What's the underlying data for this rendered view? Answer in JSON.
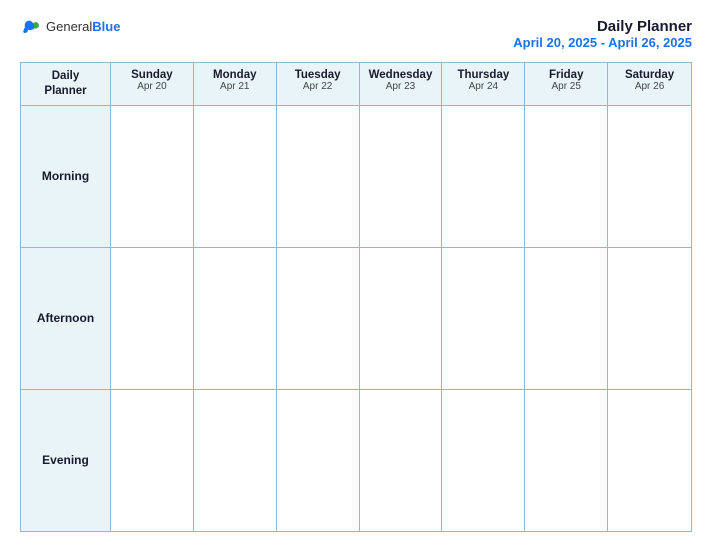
{
  "logo": {
    "general": "General",
    "blue": "Blue"
  },
  "title": {
    "main": "Daily Planner",
    "dates": "April 20, 2025 - April 26, 2025"
  },
  "header": {
    "label_line1": "Daily",
    "label_line2": "Planner",
    "columns": [
      {
        "day": "Sunday",
        "date": "Apr 20"
      },
      {
        "day": "Monday",
        "date": "Apr 21"
      },
      {
        "day": "Tuesday",
        "date": "Apr 22"
      },
      {
        "day": "Wednesday",
        "date": "Apr 23"
      },
      {
        "day": "Thursday",
        "date": "Apr 24"
      },
      {
        "day": "Friday",
        "date": "Apr 25"
      },
      {
        "day": "Saturday",
        "date": "Apr 26"
      }
    ]
  },
  "rows": [
    {
      "label": "Morning"
    },
    {
      "label": "Afternoon"
    },
    {
      "label": "Evening"
    }
  ]
}
